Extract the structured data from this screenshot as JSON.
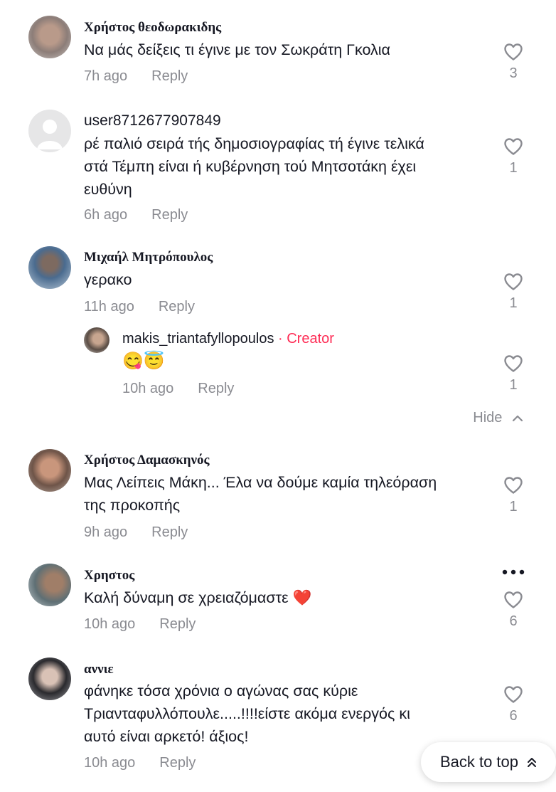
{
  "comments": [
    {
      "author": "Χρήστος θεοδωρακιδης",
      "lines": [
        "Να μάς δείξεις τι έγινε με τον Σωκράτη Γκολια"
      ],
      "time": "7h ago",
      "reply": "Reply",
      "likes": "3"
    },
    {
      "author": "user8712677907849",
      "lines": [
        "ρέ παλιό σειρά τής δημοσιογραφίας τή έγινε τελικά",
        "στά Τέμπη είναι ή κυβέρνηση τού Μητσοτάκη έχει",
        "ευθύνη"
      ],
      "time": "6h ago",
      "reply": "Reply",
      "likes": "1"
    },
    {
      "author": "Μιχαήλ Μητρόπουλος",
      "lines": [
        "γερακο"
      ],
      "time": "11h ago",
      "reply": "Reply",
      "likes": "1",
      "replies": [
        {
          "author": "makis_triantafyllopoulos",
          "badge": "· Creator",
          "text": "😋😇",
          "time": "10h ago",
          "reply": "Reply",
          "likes": "1"
        }
      ],
      "hide": "Hide"
    },
    {
      "author": "Χρήστος Δαμασκηνός",
      "lines": [
        "Μας Λείπεις Μάκη... Έλα να δούμε καμία τηλεόραση",
        "της προκοπής"
      ],
      "time": "9h ago",
      "reply": "Reply",
      "likes": "1"
    },
    {
      "author": "Χρηστος",
      "lines": [
        "Καλή δύναμη σε χρειαζόμαστε ❤️"
      ],
      "time": "10h ago",
      "reply": "Reply",
      "likes": "6"
    },
    {
      "author": "αννιε",
      "lines": [
        "φάνηκε τόσα χρόνια ο αγώνας σας κύριε",
        "Τριανταφυλλόπουλε.....!!!!είστε ακόμα ενεργός κι",
        "αυτό είναι αρκετό! άξιος!"
      ],
      "time": "10h ago",
      "reply": "Reply",
      "likes": "6"
    }
  ],
  "back_to_top": "Back to top",
  "icons": {
    "like": "heart-outline-icon",
    "more": "more-dots-icon",
    "hide": "chevron-up-icon",
    "back": "double-chevron-up-icon"
  },
  "colors": {
    "creator": "#fe2c55",
    "muted": "#8a8b91",
    "text": "#161823"
  }
}
